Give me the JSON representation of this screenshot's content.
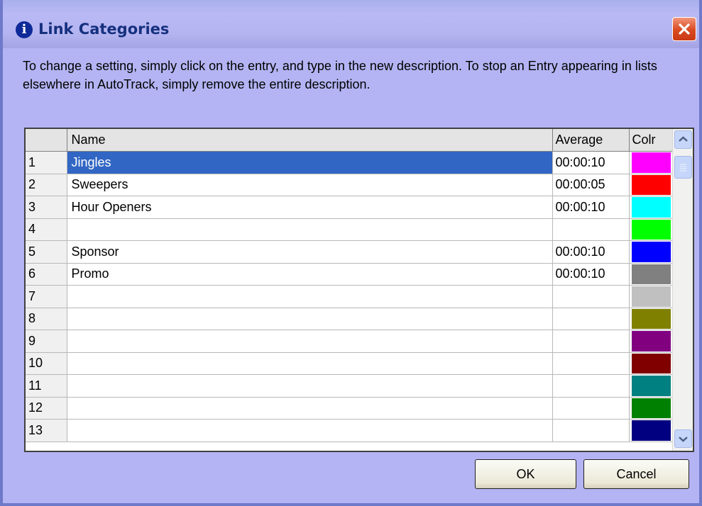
{
  "window": {
    "title": "Link Categories",
    "title_icon": "info-icon",
    "close_icon": "close-icon"
  },
  "instructions": "To change a setting, simply click on the entry, and type in the new description. To stop an Entry appearing in lists elsewhere in AutoTrack, simply remove the entire description.",
  "table": {
    "headers": {
      "num": "",
      "name": "Name",
      "average": "Average",
      "color": "Colr"
    },
    "rows": [
      {
        "num": "1",
        "name": "Jingles",
        "average": "00:00:10",
        "color": "#ff00ff",
        "selected": true
      },
      {
        "num": "2",
        "name": "Sweepers",
        "average": "00:00:05",
        "color": "#ff0000"
      },
      {
        "num": "3",
        "name": "Hour Openers",
        "average": "00:00:10",
        "color": "#00ffff"
      },
      {
        "num": "4",
        "name": "",
        "average": "",
        "color": "#00ff00"
      },
      {
        "num": "5",
        "name": "Sponsor",
        "average": "00:00:10",
        "color": "#0000ff"
      },
      {
        "num": "6",
        "name": "Promo",
        "average": "00:00:10",
        "color": "#808080"
      },
      {
        "num": "7",
        "name": "",
        "average": "",
        "color": "#c0c0c0"
      },
      {
        "num": "8",
        "name": "",
        "average": "",
        "color": "#808000"
      },
      {
        "num": "9",
        "name": "",
        "average": "",
        "color": "#800080"
      },
      {
        "num": "10",
        "name": "",
        "average": "",
        "color": "#800000"
      },
      {
        "num": "11",
        "name": "",
        "average": "",
        "color": "#008080"
      },
      {
        "num": "12",
        "name": "",
        "average": "",
        "color": "#008000"
      },
      {
        "num": "13",
        "name": "",
        "average": "",
        "color": "#000080"
      }
    ]
  },
  "scrollbar": {
    "up_icon": "chevron-up-icon",
    "down_icon": "chevron-down-icon"
  },
  "buttons": {
    "ok": "OK",
    "cancel": "Cancel"
  }
}
